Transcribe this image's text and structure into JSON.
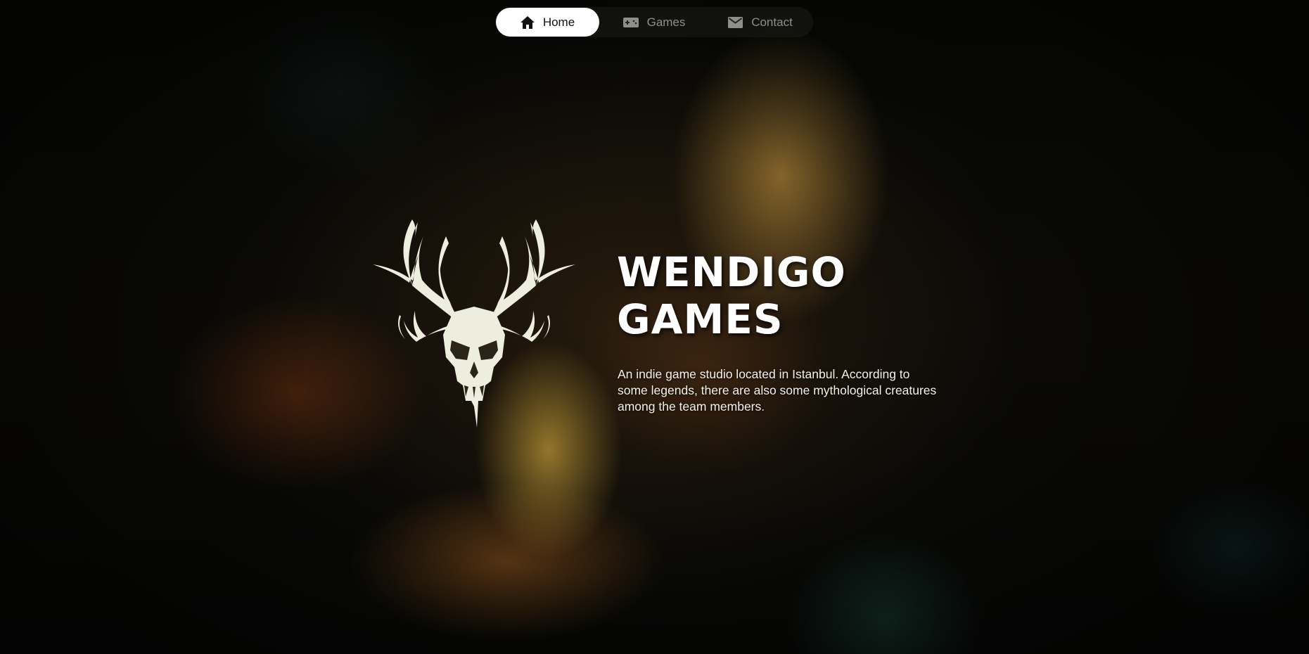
{
  "nav": {
    "items": [
      {
        "label": "Home",
        "icon": "home-icon",
        "active": true
      },
      {
        "label": "Games",
        "icon": "gamepad-icon",
        "active": false
      },
      {
        "label": "Contact",
        "icon": "mail-icon",
        "active": false
      }
    ]
  },
  "hero": {
    "title_line1": "WENDIGO",
    "title_line2": "GAMES",
    "description": "An indie game studio located in Istanbul. According to some legends, there are also some mythological creatures among the team members.",
    "logo": "wendigo-skull-antlers-logo"
  },
  "colors": {
    "nav_active_bg": "#ffffff",
    "nav_inactive_text": "#8e8e8a",
    "logo_fill": "#eeeedf",
    "title_text": "#ffffff"
  }
}
